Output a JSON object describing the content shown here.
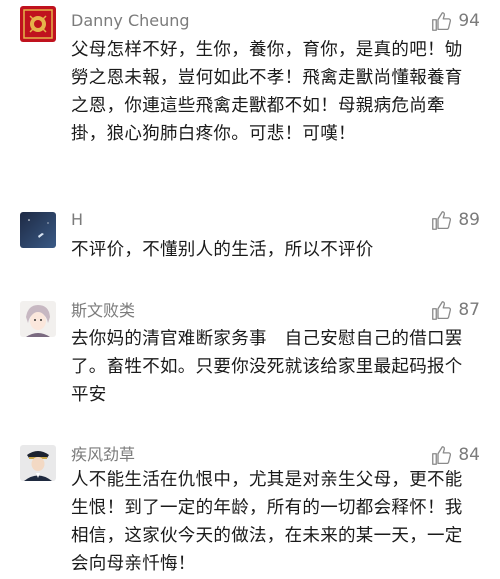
{
  "comments": [
    {
      "username": "Danny Cheung",
      "likes": "94",
      "avatar": "red-seal-avatar",
      "text": "父母怎样不好，生你，養你，育你，是真的吧！劬勞之恩未報，豈何如此不孝！飛禽走獸尚懂報養育之恩，你連這些飛禽走獸都不如！母親病危尚牽掛，狼心狗肺白疼你。可悲！可嘆！"
    },
    {
      "username": "H",
      "likes": "89",
      "avatar": "dark-sky-avatar",
      "text": "不评价，不懂别人的生活，所以不评价"
    },
    {
      "username": "斯文败类",
      "likes": "87",
      "avatar": "anime-person-avatar",
      "text": "去你妈的清官难断家务事　自己安慰自己的借口罢了。畜牲不如。只要你没死就该给家里最起码报个平安"
    },
    {
      "username": "疾风劲草",
      "likes": "84",
      "avatar": "officer-avatar",
      "text": "人不能生活在仇恨中，尤其是对亲生父母，更不能生恨！到了一定的年龄，所有的一切都会释怀！我相信，这家伙今天的做法，在未来的某一天，一定会向母亲忏悔！"
    }
  ],
  "colors": {
    "username": "#7b7b7b",
    "body_text": "#1a1a1a",
    "like_icon": "#8a8a8a",
    "divider": "#e6e6e6"
  }
}
